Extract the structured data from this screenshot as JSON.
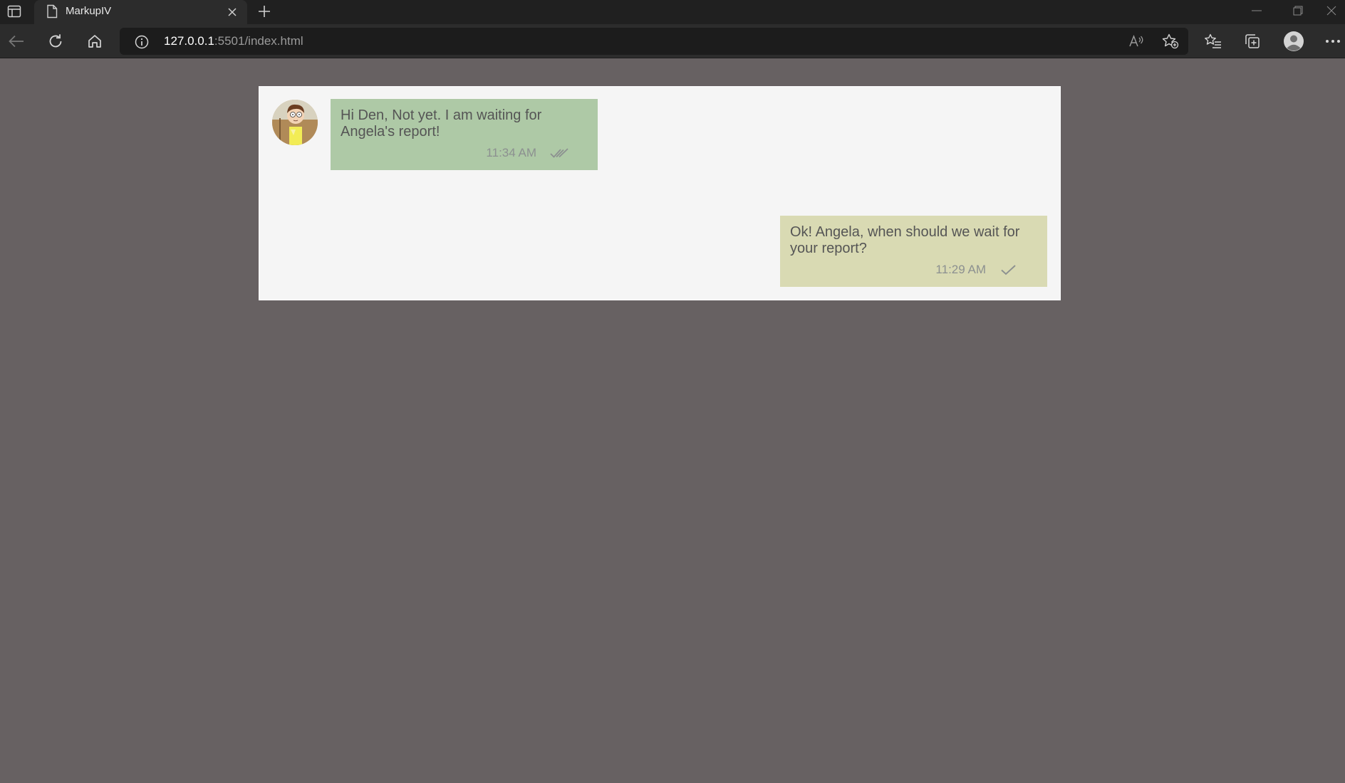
{
  "browser": {
    "tab_title": "MarkupIV",
    "url_host": "127.0.0.1",
    "url_rest": ":5501/index.html"
  },
  "chat": {
    "messages": [
      {
        "direction": "incoming",
        "text": "Hi Den, Not yet. I am waiting for Angela's report!",
        "time": "11:34 AM",
        "status": "double-check-icon",
        "color": "#aec9a6"
      },
      {
        "direction": "outgoing",
        "text": "Ok! Angela, when should we wait for your report?",
        "time": "11:29 AM",
        "status": "single-check-icon",
        "color": "#d9dab3"
      }
    ]
  },
  "colors": {
    "page_background": "#676162",
    "chat_background": "#f5f5f5"
  }
}
